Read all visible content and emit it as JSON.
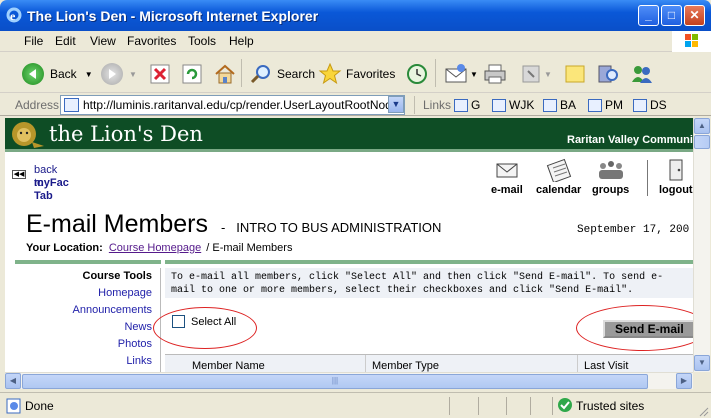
{
  "window": {
    "title": "The Lion's Den - Microsoft Internet Explorer",
    "minimize_glyph": "_",
    "maximize_glyph": "□",
    "close_glyph": "✕"
  },
  "menu": {
    "items": [
      "File",
      "Edit",
      "View",
      "Favorites",
      "Tools",
      "Help"
    ]
  },
  "toolbar": {
    "back": "Back",
    "search": "Search",
    "favorites": "Favorites"
  },
  "address": {
    "label": "Address",
    "url": "http://luminis.raritanval.edu/cp/render.UserLayoutRootNode.ul",
    "links_label": "Links",
    "links": [
      "G",
      "WJK",
      "BA",
      "PM",
      "DS"
    ]
  },
  "banner": {
    "brand": "the Lion's Den",
    "college": "Raritan Valley Community C"
  },
  "back_link": {
    "line1": "back to",
    "line2": "myFac Tab"
  },
  "nav_icons": {
    "email": "e-mail",
    "calendar": "calendar",
    "groups": "groups",
    "logout": "logout"
  },
  "page": {
    "title": "E-mail Members",
    "title_separator": "-",
    "course": "INTRO TO BUS ADMINISTRATION",
    "date": "September 17, 200",
    "location_label": "Your Location:",
    "location_link": "Course Homepage",
    "location_current": "/ E-mail Members"
  },
  "sidenav": {
    "heading": "Course Tools",
    "links": [
      "Homepage",
      "Announcements",
      "News",
      "Photos",
      "Links"
    ]
  },
  "content": {
    "instructions": "To e-mail all members, click \"Select All\" and then click \"Send E-mail\". To send e-mail to one or more members, select their checkboxes and click \"Send E-mail\".",
    "select_all": "Select All",
    "send_button": "Send E-mail",
    "columns": [
      "Member Name",
      "Member Type",
      "Last Visit"
    ]
  },
  "status": {
    "text": "Done",
    "zone": "Trusted sites"
  },
  "colors": {
    "banner_green": "#0e4d25",
    "annotation_red": "#dd2222",
    "xp_blue": "#0a58d8"
  }
}
